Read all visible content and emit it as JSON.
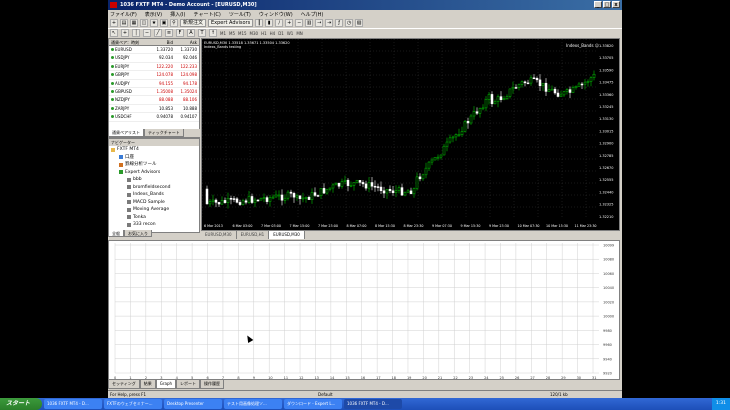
{
  "window": {
    "title": "1036 FXTF MT4 - Demo Account - [EURUSD,M30]",
    "controls": [
      "_",
      "□",
      "x"
    ]
  },
  "menu": [
    "ファイル(F)",
    "表示(V)",
    "挿入(I)",
    "チャート(C)",
    "ツール(T)",
    "ウィンドウ(W)",
    "ヘルプ(H)"
  ],
  "toolbar": {
    "new_order": "新規注文",
    "expert_advisors": "Expert Advisors",
    "timeframes": [
      "M1",
      "M5",
      "M15",
      "M30",
      "H1",
      "H4",
      "D1",
      "W1",
      "MN"
    ]
  },
  "market_watch": {
    "headers": [
      "通貨ペア：時刻",
      "Bid",
      "Ask"
    ],
    "rows": [
      {
        "symbol": "EURUSD",
        "bid": "1.33720",
        "ask": "1.33730",
        "color": "#000000"
      },
      {
        "symbol": "USDJPY",
        "bid": "92.034",
        "ask": "92.046",
        "color": "#000000"
      },
      {
        "symbol": "EURJPY",
        "bid": "122.220",
        "ask": "122.233",
        "color": "#cc0000"
      },
      {
        "symbol": "GBPJPY",
        "bid": "124.078",
        "ask": "124.098",
        "color": "#cc0000"
      },
      {
        "symbol": "AUDJPY",
        "bid": "94.155",
        "ask": "94.178",
        "color": "#cc0000"
      },
      {
        "symbol": "GBPUSD",
        "bid": "1.35008",
        "ask": "1.35024",
        "color": "#cc0000"
      },
      {
        "symbol": "NZDJPY",
        "bid": "88.088",
        "ask": "88.106",
        "color": "#cc0000"
      },
      {
        "symbol": "ZARJPY",
        "bid": "10.853",
        "ask": "10.888",
        "color": "#000000"
      },
      {
        "symbol": "USDCHF",
        "bid": "0.94078",
        "ask": "0.94107",
        "color": "#000000"
      }
    ],
    "tabs": [
      "通貨ペアリスト",
      "ティックチャート"
    ]
  },
  "navigator": {
    "header": "ナビゲーター",
    "items": [
      {
        "label": "FXTF MT4",
        "indent": 0,
        "icon": "folder-icon"
      },
      {
        "label": "口座",
        "indent": 1,
        "icon": "accounts-icon"
      },
      {
        "label": "罫線分析ツール",
        "indent": 1,
        "icon": "indicators-icon"
      },
      {
        "label": "Expert Advisors",
        "indent": 1,
        "icon": "experts-icon"
      },
      {
        "label": "bbb",
        "indent": 2,
        "icon": "expert-icon"
      },
      {
        "label": "bromfieldsecond",
        "indent": 2,
        "icon": "expert-icon"
      },
      {
        "label": "Indexs_Bands",
        "indent": 2,
        "icon": "expert-icon"
      },
      {
        "label": "MACD Sample",
        "indent": 2,
        "icon": "expert-icon"
      },
      {
        "label": "Moving Average",
        "indent": 2,
        "icon": "expert-icon"
      },
      {
        "label": "Tonka",
        "indent": 2,
        "icon": "expert-icon"
      },
      {
        "label": "333 recon",
        "indent": 2,
        "icon": "expert-icon"
      }
    ],
    "tabs": [
      "全般",
      "お気に入り"
    ]
  },
  "chart": {
    "info_line1": "EURUSD,M30 1.33518 1.33671 1.33504 1.33620",
    "info_line2": "Indexs_Bands testing",
    "ea_label": "Indexs_Bands ☺",
    "price_labels": [
      "1.33820",
      "1.33705",
      "1.33590",
      "1.33475",
      "1.33360",
      "1.33245",
      "1.33130",
      "1.33015",
      "1.32900",
      "1.32785",
      "1.32670",
      "1.32555",
      "1.32440",
      "1.32325",
      "1.32210"
    ],
    "time_labels": [
      "6 Mar 2013",
      "6 Mar 03:00",
      "7 Mar 03:00",
      "7 Mar 15:00",
      "7 Mar 23:00",
      "8 Mar 07:00",
      "8 Mar 15:30",
      "8 Mar 23:30",
      "9 Mar 07:30",
      "9 Mar 15:30",
      "9 Mar 23:30",
      "10 Mar 07:30",
      "10 Mar 15:30",
      "11 Mar 23:30"
    ],
    "tabs": [
      "EURUSD,M30",
      "EURUSD,H1",
      "EURUSD,M30"
    ],
    "active_tab": 2,
    "bull_color": "#00c000",
    "bear_color": "#ffffff"
  },
  "tester": {
    "y_labels": [
      "10099",
      "10080",
      "10060",
      "10040",
      "10020",
      "10000",
      "9980",
      "9960",
      "9940",
      "9920"
    ],
    "x_labels": [
      "0",
      "1",
      "2",
      "3",
      "4",
      "5",
      "6",
      "7",
      "8",
      "9",
      "10",
      "11",
      "12",
      "13",
      "14",
      "15",
      "16",
      "17",
      "18",
      "19",
      "20",
      "21",
      "22",
      "23",
      "24",
      "25",
      "26",
      "27",
      "28",
      "29",
      "30",
      "31"
    ],
    "tabs": [
      "セッティング",
      "結果",
      "Graph",
      "レポート",
      "操作履歴"
    ],
    "active_tab": 2
  },
  "status": {
    "left": "For Help, press F1",
    "middle": "Default",
    "right": "120/1 kb"
  },
  "taskbar": {
    "start": "スタート",
    "tasks": [
      "1036 FXTF MT4 - D...",
      "FXTFのウェブセミナー...",
      "Desktop Presenter",
      "テスト用画像処理ソ...",
      "ダウンロード - Expert L...",
      "1036 FXTF MT4 - D..."
    ],
    "active_task": 5,
    "clock": "1:31"
  },
  "cursor_visible": true
}
